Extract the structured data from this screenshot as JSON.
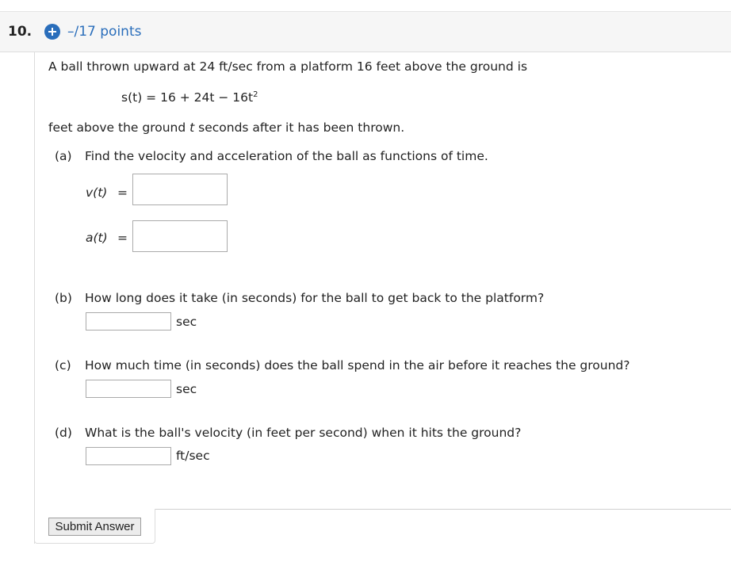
{
  "question": {
    "number": "10.",
    "points": "–/17 points"
  },
  "problem": {
    "intro": "A ball thrown upward at 24 ft/sec from a platform 16 feet above the ground is",
    "equation_lhs": "s(t) = 16 + 24t − 16t",
    "equation_exp": "2",
    "after_a": "feet above the ground ",
    "after_t": "t",
    "after_b": " seconds after it has been thrown."
  },
  "part_a": {
    "label": "(a)",
    "prompt": "Find the velocity and acceleration of the ball as functions of time.",
    "v_label": "v(t)",
    "a_label": "a(t)",
    "eq": "=",
    "v_value": "",
    "a_value": ""
  },
  "part_b": {
    "label": "(b)",
    "prompt": "How long does it take (in seconds) for the ball to get back to the platform?",
    "unit": "sec",
    "value": ""
  },
  "part_c": {
    "label": "(c)",
    "prompt": "How much time (in seconds) does the ball spend in the air before it reaches the ground?",
    "unit": "sec",
    "value": ""
  },
  "part_d": {
    "label": "(d)",
    "prompt": "What is the ball's velocity (in feet per second) when it hits the ground?",
    "unit": "ft/sec",
    "value": ""
  },
  "submit_label": "Submit Answer",
  "colors": {
    "accent": "#2a6ebb",
    "header_bg": "#f6f6f6"
  }
}
